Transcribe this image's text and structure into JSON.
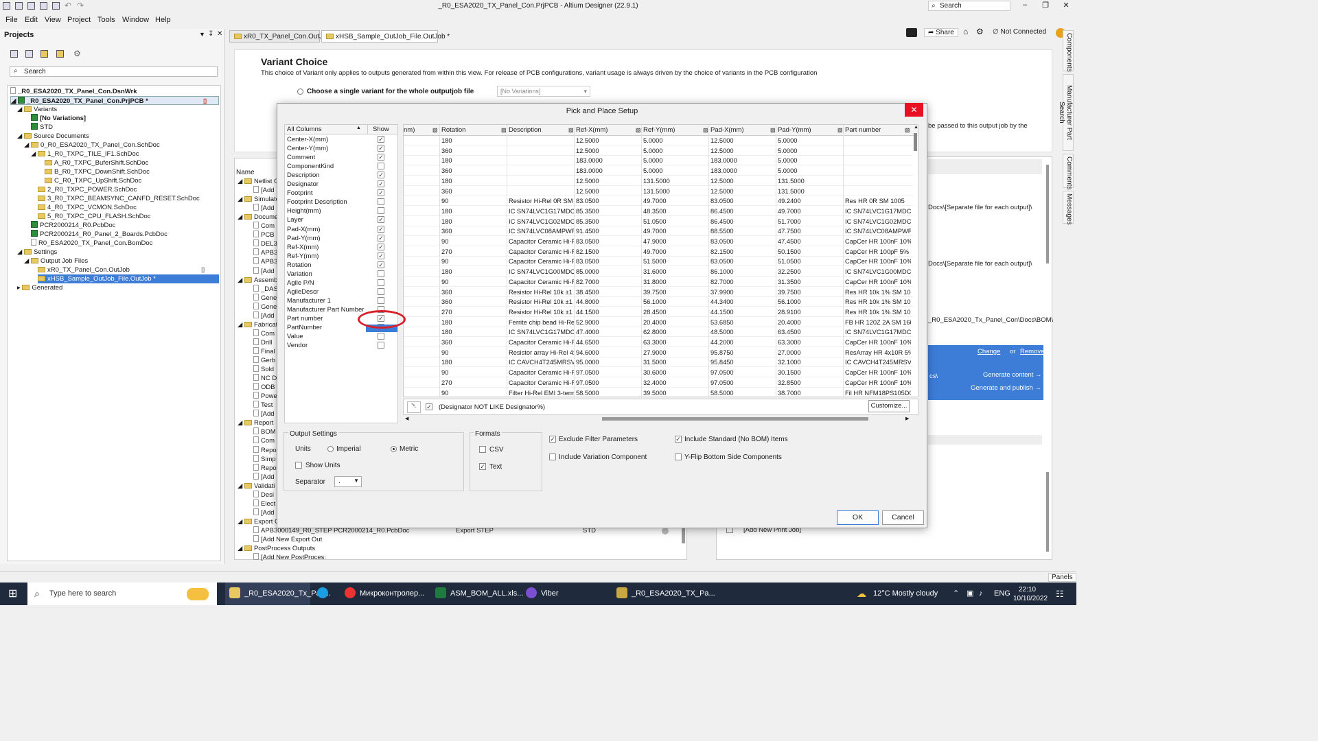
{
  "app": {
    "title": "_R0_ESA2020_TX_Panel_Con.PrjPCB - Altium Designer (22.9.1)",
    "search_placeholder": "Search",
    "menu": [
      "File",
      "Edit",
      "View",
      "Project",
      "Tools",
      "Window",
      "Help"
    ],
    "share": "Share",
    "connection": "Not Connected"
  },
  "projects": {
    "title": "Projects",
    "search_placeholder": "Search",
    "tree": [
      "_R0_ESA2020_TX_Panel_Con.DsnWrk",
      "_R0_ESA2020_TX_Panel_Con.PrjPCB *",
      "Variants",
      "[No Variations]",
      "STD",
      "Source Documents",
      "0_R0_ESA2020_TX_Panel_Con.SchDoc",
      "1_R0_TXPC_TILE_IF1.SchDoc",
      "A_R0_TXPC_BuferShift.SchDoc",
      "B_R0_TXPC_DownShift.SchDoc",
      "C_R0_TXPC_UpShift.SchDoc",
      "2_R0_TXPC_POWER.SchDoc",
      "3_R0_TXPC_BEAMSYNC_CANFD_RESET.SchDoc",
      "4_R0_TXPC_VCMON.SchDoc",
      "5_R0_TXPC_CPU_FLASH.SchDoc",
      "PCR2000214_R0.PcbDoc",
      "PCR2000214_R0_Panel_2_Boards.PcbDoc",
      "R0_ESA2020_TX_Panel_Con.BomDoc",
      "Settings",
      "Output Job Files",
      "xR0_TX_Panel_Con.OutJob",
      "xHSB_Sample_OutJob_File.OutJob *",
      "Generated"
    ]
  },
  "tabs": [
    "xR0_TX_Panel_Con.OutJob",
    "xHSB_Sample_OutJob_File.OutJob *"
  ],
  "variant": {
    "title": "Variant Choice",
    "desc": "This choice of Variant only applies to outputs generated from within this view. For release of PCB configurations, variant usage is always driven by the choice of variants in the PCB configuration",
    "option": "Choose a single variant for the whole outputjob file",
    "select": "[No Variations]",
    "passed": "be passed to this output job by the"
  },
  "mid": {
    "name_header": "Name",
    "rows": [
      "Netlist O",
      "[Add",
      "Simulato",
      "[Add",
      "Docume",
      "Com",
      "PCB I",
      "DEL3",
      "APB3",
      "APB3",
      "[Add",
      "Assemb",
      "_DAS",
      "Gene",
      "Gene",
      "[Add",
      "Fabricat",
      "Com",
      "Drill",
      "Final",
      "Gerb",
      "Sold",
      "NC D",
      "ODB",
      "Powe",
      "Test",
      "[Add",
      "Report",
      "BOM",
      "Com",
      "Repo",
      "Simp",
      "Repo",
      "[Add",
      "Validati",
      "Desi",
      "Elect",
      "[Add",
      "Export O",
      "APB3000149_R0_STEP PCR2000214_R0.PcbDoc",
      "[Add New Export Out",
      "PostProcess Outputs",
      "[Add New PostProces:"
    ],
    "export_step": "Export STEP",
    "std": "STD"
  },
  "right": {
    "docs1": "Docs\\[Separate file for each output]\\",
    "docs2": "Docs\\[Separate file for each output]\\",
    "bom_path": "_R0_ESA2020_Tx_Panel_Con\\Docs\\BOM\\",
    "change": "Change",
    "or": "or",
    "remove": "Remove",
    "cs": "cs\\",
    "gen_content": "Generate content →",
    "gen_publish": "Generate and publish →",
    "add_print": "[Add New Print Job]"
  },
  "sidetabs": [
    "Components",
    "Manufacturer Part Search",
    "Comments",
    "Messages"
  ],
  "dialog": {
    "title": "Pick and Place Setup",
    "all_columns": "All Columns",
    "show": "Show",
    "columns": [
      {
        "name": "Center-X(mm)",
        "show": true
      },
      {
        "name": "Center-Y(mm)",
        "show": true
      },
      {
        "name": "Comment",
        "show": true
      },
      {
        "name": "ComponentKind",
        "show": false
      },
      {
        "name": "Description",
        "show": true
      },
      {
        "name": "Designator",
        "show": true
      },
      {
        "name": "Footprint",
        "show": true
      },
      {
        "name": "Footprint Description",
        "show": false
      },
      {
        "name": "Height(mm)",
        "show": false
      },
      {
        "name": "Layer",
        "show": true
      },
      {
        "name": "Pad-X(mm)",
        "show": true
      },
      {
        "name": "Pad-Y(mm)",
        "show": true
      },
      {
        "name": "Ref-X(mm)",
        "show": true
      },
      {
        "name": "Ref-Y(mm)",
        "show": true
      },
      {
        "name": "Rotation",
        "show": true
      },
      {
        "name": "Variation",
        "show": false
      },
      {
        "name": "Agile P/N",
        "show": false
      },
      {
        "name": "AgileDescr",
        "show": false
      },
      {
        "name": "Manufacturer 1",
        "show": false
      },
      {
        "name": "Manufacturer Part Number",
        "show": false
      },
      {
        "name": "Part number",
        "show": true
      },
      {
        "name": "PartNumber",
        "show": false
      },
      {
        "name": "Value",
        "show": false
      },
      {
        "name": "Vendor",
        "show": false
      }
    ],
    "grid_headers": [
      "nm)",
      "Rotation",
      "Description",
      "Ref-X(mm)",
      "Ref-Y(mm)",
      "Pad-X(mm)",
      "Pad-Y(mm)",
      "Part number"
    ],
    "rows": [
      [
        "180",
        "",
        "12.5000",
        "5.0000",
        "12.5000",
        "5.0000",
        ""
      ],
      [
        "360",
        "",
        "12.5000",
        "5.0000",
        "12.5000",
        "5.0000",
        ""
      ],
      [
        "180",
        "",
        "183.0000",
        "5.0000",
        "183.0000",
        "5.0000",
        ""
      ],
      [
        "360",
        "",
        "183.0000",
        "5.0000",
        "183.0000",
        "5.0000",
        ""
      ],
      [
        "180",
        "",
        "12.5000",
        "131.5000",
        "12.5000",
        "131.5000",
        ""
      ],
      [
        "360",
        "",
        "12.5000",
        "131.5000",
        "12.5000",
        "131.5000",
        ""
      ],
      [
        "90",
        "Resistor Hi-Rel 0R SM",
        "83.0500",
        "49.7000",
        "83.0500",
        "49.2400",
        "Res HR 0R SM 1005"
      ],
      [
        "180",
        "IC SN74LVC1G17MDCK",
        "85.3500",
        "48.3500",
        "86.4500",
        "49.7000",
        "IC SN74LVC1G17MDCK"
      ],
      [
        "180",
        "IC SN74LVC1G02MDCK",
        "85.3500",
        "51.0500",
        "86.4500",
        "51.7000",
        "IC SN74LVC1G02MDCK"
      ],
      [
        "360",
        "IC SN74LVC08AMPWRE",
        "91.4500",
        "49.7000",
        "88.5500",
        "47.7500",
        "IC SN74LVC08AMPWRE"
      ],
      [
        "90",
        "Capacitor Ceramic Hi-F",
        "83.0500",
        "47.9000",
        "83.0500",
        "47.4500",
        "CapCer HR 100nF 10%"
      ],
      [
        "270",
        "Capacitor Ceramic Hi-F",
        "82.1500",
        "49.7000",
        "82.1500",
        "50.1500",
        "CapCer HR 100pF 5% 5"
      ],
      [
        "90",
        "Capacitor Ceramic Hi-F",
        "83.0500",
        "51.5000",
        "83.0500",
        "51.0500",
        "CapCer HR 100nF 10%"
      ],
      [
        "180",
        "IC SN74LVC1G00MDCK",
        "85.0000",
        "31.6000",
        "86.1000",
        "32.2500",
        "IC SN74LVC1G00MDCK"
      ],
      [
        "90",
        "Capacitor Ceramic Hi-F",
        "82.7000",
        "31.8000",
        "82.7000",
        "31.3500",
        "CapCer HR 100nF 10%"
      ],
      [
        "360",
        "Resistor Hi-Rel 10k ±1",
        "38.4500",
        "39.7500",
        "37.9900",
        "39.7500",
        "Res HR 10k 1% SM 100"
      ],
      [
        "360",
        "Resistor Hi-Rel 10k ±1",
        "44.8000",
        "56.1000",
        "44.3400",
        "56.1000",
        "Res HR 10k 1% SM 100"
      ],
      [
        "270",
        "Resistor Hi-Rel 10k ±1",
        "44.1500",
        "28.4500",
        "44.1500",
        "28.9100",
        "Res HR 10k 1% SM 100"
      ],
      [
        "180",
        "Ferrite chip bead Hi-Re",
        "52.9000",
        "20.4000",
        "53.6850",
        "20.4000",
        "FB HR 120Z 2A SM 160"
      ],
      [
        "180",
        "IC SN74LVC1G17MDCK",
        "47.4000",
        "62.8000",
        "48.5000",
        "63.4500",
        "IC SN74LVC1G17MDCK"
      ],
      [
        "360",
        "Capacitor Ceramic Hi-F",
        "44.6500",
        "63.3000",
        "44.2000",
        "63.3000",
        "CapCer HR 100nF 10%"
      ],
      [
        "90",
        "Resistor array Hi-Rel 4x",
        "94.6000",
        "27.9000",
        "95.8750",
        "27.0000",
        "ResArray HR 4x10R 5%"
      ],
      [
        "180",
        "IC CAVCH4T245MRSVR",
        "95.0000",
        "31.5000",
        "95.8450",
        "32.1000",
        "IC CAVCH4T245MRSVR"
      ],
      [
        "90",
        "Capacitor Ceramic Hi-F",
        "97.0500",
        "30.6000",
        "97.0500",
        "30.1500",
        "CapCer HR 100nF 10%"
      ],
      [
        "270",
        "Capacitor Ceramic Hi-F",
        "97.0500",
        "32.4000",
        "97.0500",
        "32.8500",
        "CapCer HR 100nF 10%"
      ],
      [
        "90",
        "Filter Hi-Rel EMI 3-term",
        "58.5000",
        "39.5000",
        "58.5000",
        "38.7000",
        "Fil HR NFM18PS105D0."
      ]
    ],
    "filter": "(Designator NOT LIKE Designator%)",
    "customize": "Customize...",
    "output_settings": "Output Settings",
    "units": "Units",
    "imperial": "Imperial",
    "metric": "Metric",
    "show_units": "Show Units",
    "separator": "Separator",
    "separator_value": ".",
    "formats": "Formats",
    "csv": "CSV",
    "text": "Text",
    "exclude_filter": "Exclude Filter Parameters",
    "include_variation": "Include Variation Component",
    "include_standard": "Include Standard (No BOM) Items",
    "yflip": "Y-Flip Bottom Side Components",
    "ok": "OK",
    "cancel": "Cancel"
  },
  "status": {
    "panels": "Panels"
  },
  "taskbar": {
    "search_placeholder": "Type here to search",
    "apps": [
      "_R0_ESA2020_Tx_Pan...",
      "Микроконтролер...",
      "ASM_BOM_ALL.xls...",
      "Viber",
      "_R0_ESA2020_TX_Pa..."
    ],
    "weather": "12°C  Mostly cloudy",
    "lang": "ENG",
    "time": "22:10",
    "date": "10/10/2022"
  }
}
